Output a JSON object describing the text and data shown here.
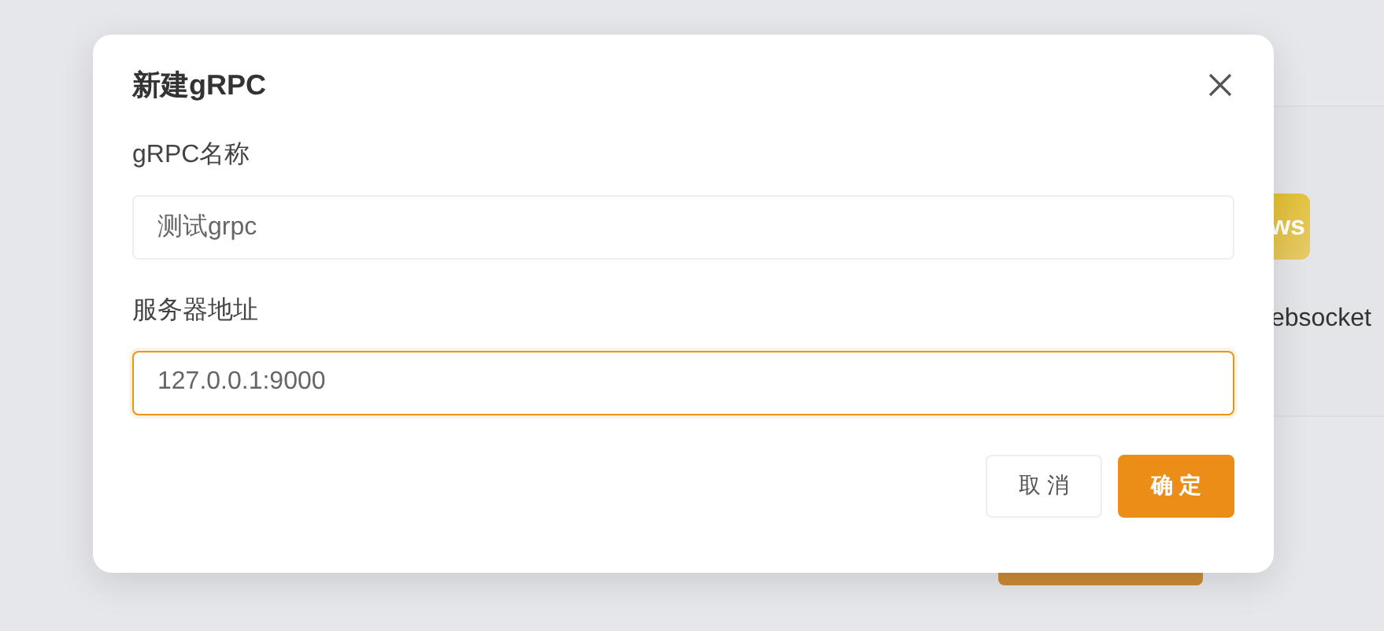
{
  "background": {
    "app_icon_text": "ws",
    "app_name": "ebsocket"
  },
  "dialog": {
    "title": "新建gRPC",
    "fields": [
      {
        "label": "gRPC名称",
        "value": "测试grpc",
        "focused": false
      },
      {
        "label": "服务器地址",
        "value": "127.0.0.1:9000",
        "focused": true
      }
    ],
    "buttons": [
      {
        "label": "取消",
        "kind": "default"
      },
      {
        "label": "确定",
        "kind": "primary"
      }
    ]
  }
}
